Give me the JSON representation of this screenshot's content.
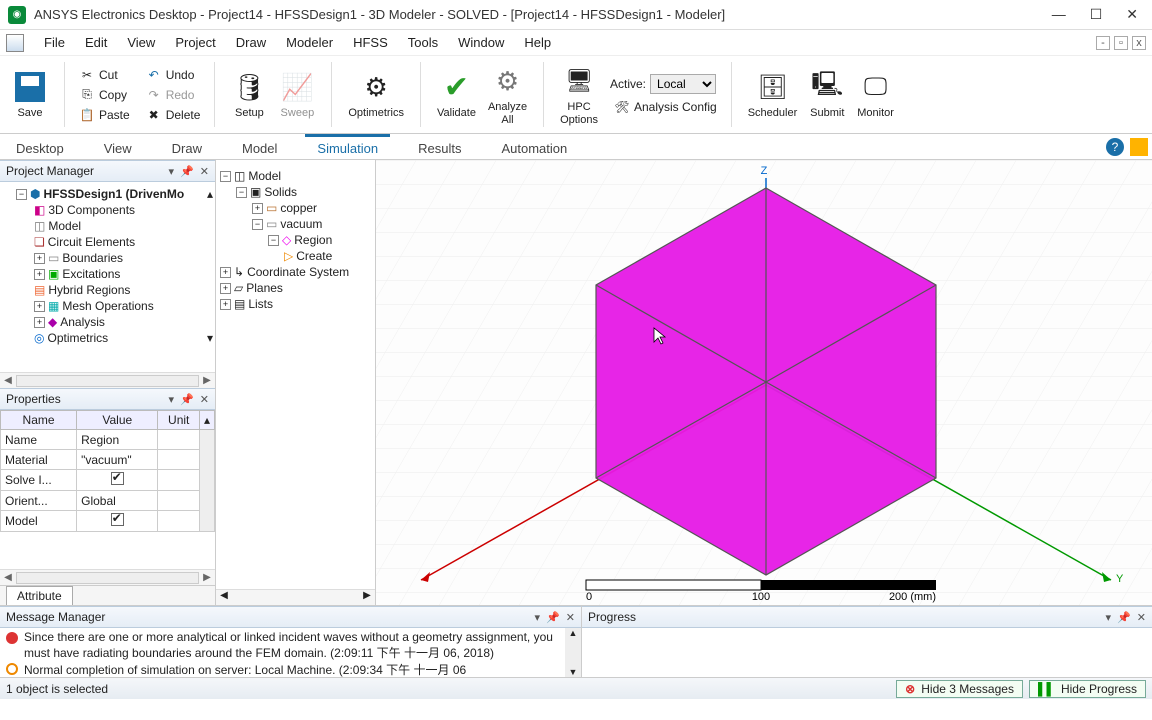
{
  "title": "ANSYS Electronics Desktop - Project14 - HFSSDesign1 - 3D Modeler - SOLVED - [Project14 - HFSSDesign1 - Modeler]",
  "menu": {
    "file": "File",
    "edit": "Edit",
    "view": "View",
    "project": "Project",
    "draw": "Draw",
    "modeler": "Modeler",
    "hfss": "HFSS",
    "tools": "Tools",
    "window": "Window",
    "help": "Help"
  },
  "ribbon": {
    "save": "Save",
    "cut": "Cut",
    "copy": "Copy",
    "paste": "Paste",
    "undo": "Undo",
    "redo": "Redo",
    "delete": "Delete",
    "setup": "Setup",
    "sweep": "Sweep",
    "optimetrics": "Optimetrics",
    "validate": "Validate",
    "analyze": "Analyze\nAll",
    "hpc": "HPC\nOptions",
    "active_label": "Active:",
    "active_value": "Local",
    "analysis_config": "Analysis Config",
    "scheduler": "Scheduler",
    "submit": "Submit",
    "monitor": "Monitor"
  },
  "tabs": {
    "desktop": "Desktop",
    "view": "View",
    "draw": "Draw",
    "model": "Model",
    "simulation": "Simulation",
    "results": "Results",
    "automation": "Automation"
  },
  "pm": {
    "title": "Project Manager",
    "root": "HFSSDesign1 (DrivenMo",
    "items": [
      "3D Components",
      "Model",
      "Circuit Elements",
      "Boundaries",
      "Excitations",
      "Hybrid Regions",
      "Mesh Operations",
      "Analysis",
      "Optimetrics"
    ]
  },
  "props": {
    "title": "Properties",
    "col_name": "Name",
    "col_value": "Value",
    "col_unit": "Unit",
    "rows": [
      {
        "n": "Name",
        "v": "Region",
        "u": ""
      },
      {
        "n": "Material",
        "v": "\"vacuum\"",
        "u": ""
      },
      {
        "n": "Solve I...",
        "v": "_chk",
        "u": ""
      },
      {
        "n": "Orient...",
        "v": "Global",
        "u": ""
      },
      {
        "n": "Model",
        "v": "_chk",
        "u": ""
      }
    ],
    "attr_tab": "Attribute"
  },
  "model_tree": {
    "model": "Model",
    "solids": "Solids",
    "copper": "copper",
    "vacuum": "vacuum",
    "region": "Region",
    "create": "Create",
    "coord": "Coordinate System",
    "planes": "Planes",
    "lists": "Lists"
  },
  "axes": {
    "z": "Z",
    "y": "Y"
  },
  "scale": {
    "t0": "0",
    "t1": "100",
    "t2": "200 (mm)"
  },
  "msg": {
    "title": "Message Manager",
    "l1": "Since there are one or more analytical or linked incident waves without a geometry assignment, you must have radiating boundaries around the FEM domain. (2:09:11 下午 十一月 06, 2018)",
    "l2": "Normal completion of simulation on server: Local Machine. (2:09:34 下午 十一月 06"
  },
  "progress": {
    "title": "Progress"
  },
  "status": {
    "sel": "1 object is selected",
    "hide_msg": "Hide 3 Messages",
    "hide_prog": "Hide Progress"
  }
}
